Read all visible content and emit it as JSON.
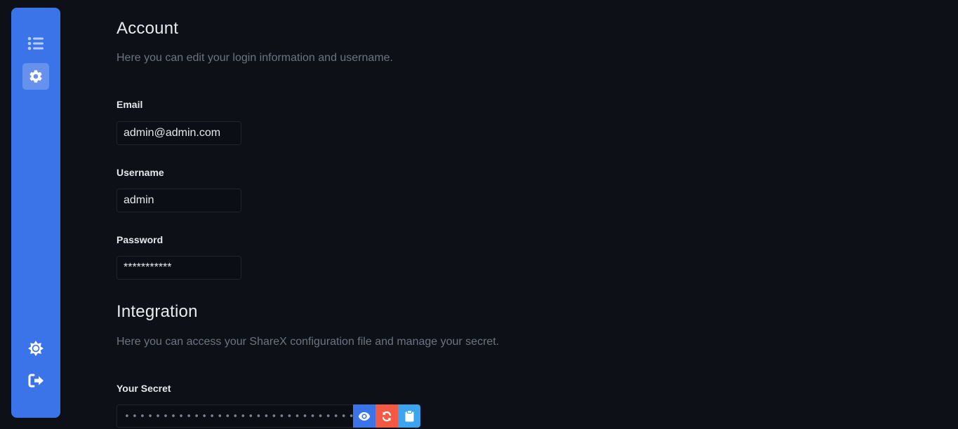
{
  "sidebar": {
    "items": [
      {
        "icon": "list-icon",
        "active": false
      },
      {
        "icon": "gear-icon",
        "active": true
      }
    ],
    "bottom_items": [
      {
        "icon": "theme-toggle-icon"
      },
      {
        "icon": "logout-icon"
      }
    ],
    "accent_color": "#3b74e8"
  },
  "account": {
    "title": "Account",
    "description": "Here you can edit your login information and username.",
    "email_label": "Email",
    "email_value": "admin@admin.com",
    "username_label": "Username",
    "username_value": "admin",
    "password_label": "Password",
    "password_value": "***********"
  },
  "integration": {
    "title": "Integration",
    "description": "Here you can access your ShareX configuration file and manage your secret.",
    "secret_label": "Your Secret",
    "secret_value": "••••••••••••••••••••••••••••••••",
    "buttons": [
      {
        "icon": "eye-icon",
        "color": "#3b74e8"
      },
      {
        "icon": "refresh-icon",
        "color": "#f45a43"
      },
      {
        "icon": "clipboard-icon",
        "color": "#3da4ee"
      }
    ]
  }
}
